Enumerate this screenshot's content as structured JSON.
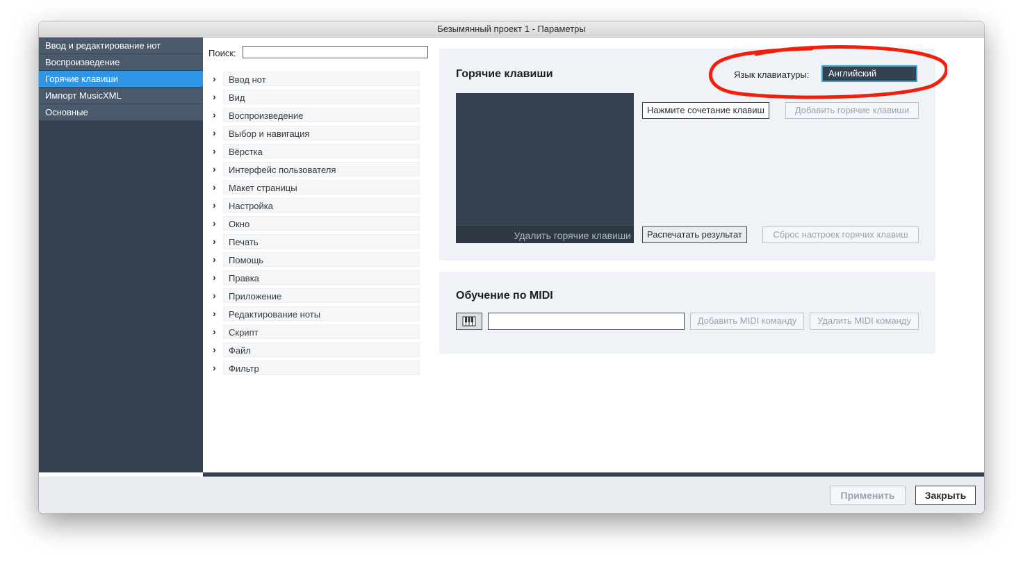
{
  "window": {
    "title": "Безымянный проект 1 - Параметры"
  },
  "sidebar": {
    "items": [
      {
        "label": "Ввод и редактирование нот",
        "active": false
      },
      {
        "label": "Воспроизведение",
        "active": false
      },
      {
        "label": "Горячие клавиши",
        "active": true
      },
      {
        "label": "Импорт MusicXML",
        "active": false
      },
      {
        "label": "Основные",
        "active": false
      }
    ]
  },
  "search": {
    "label": "Поиск:",
    "value": "",
    "placeholder": ""
  },
  "tree": {
    "items": [
      "Ввод нот",
      "Вид",
      "Воспроизведение",
      "Выбор и навигация",
      "Вёрстка",
      "Интерфейс пользователя",
      "Макет страницы",
      "Настройка",
      "Окно",
      "Печать",
      "Помощь",
      "Правка",
      "Приложение",
      "Редактирование ноты",
      "Скрипт",
      "Файл",
      "Фильтр"
    ]
  },
  "hotkeys": {
    "title": "Горячие клавиши",
    "keyboard_language_label": "Язык клавиатуры:",
    "keyboard_language_value": "Английский",
    "press_combination_button": "Нажмите сочетание клавиш",
    "add_hotkeys_button": "Добавить горячие клавиши",
    "delete_hotkeys_button": "Удалить горячие клавиши",
    "print_result_button": "Распечатать результат",
    "reset_hotkeys_button": "Сброс настроек горячих клавиш"
  },
  "midi": {
    "title": "Обучение по MIDI",
    "input_value": "",
    "add_command_button": "Добавить MIDI команду",
    "delete_command_button": "Удалить MIDI команду"
  },
  "footer": {
    "apply_button": "Применить",
    "close_button": "Закрыть"
  },
  "colors": {
    "sidebar_bg": "#364250",
    "sidebar_item_bg": "#4b5a6a",
    "sidebar_active": "#2f96e6",
    "panel_bg": "#eff3f8",
    "annotation_red": "#f0200d",
    "select_focus": "#3aa0d8"
  }
}
